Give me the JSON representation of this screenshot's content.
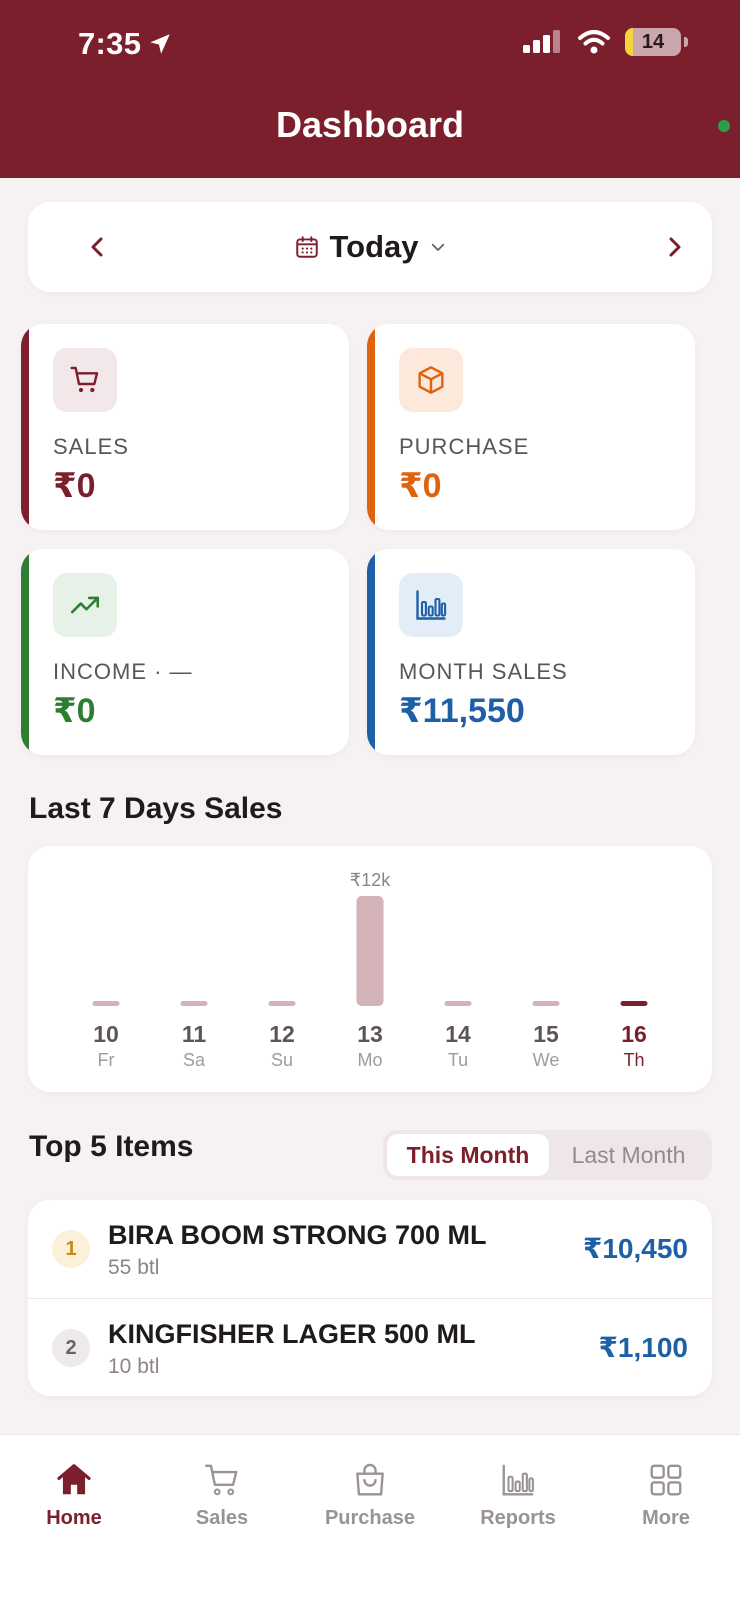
{
  "status_bar": {
    "time": "7:35",
    "battery": "14"
  },
  "header": {
    "title": "Dashboard"
  },
  "date_selector": {
    "label": "Today"
  },
  "stats": {
    "sales": {
      "label": "SALES",
      "value": "₹0",
      "color": "#7a1f2b",
      "icon": "cart-icon"
    },
    "purchase": {
      "label": "PURCHASE",
      "value": "₹0",
      "color": "#e0620f",
      "icon": "box-icon"
    },
    "income": {
      "label": "INCOME · —",
      "value": "₹0",
      "color": "#2e7d32",
      "icon": "trend-up-icon"
    },
    "month_sales": {
      "label": "MONTH SALES",
      "value": "₹11,550",
      "color": "#1f5fa8",
      "icon": "bar-chart-icon"
    }
  },
  "chart_section": {
    "title": "Last 7 Days Sales"
  },
  "chart_data": {
    "type": "bar",
    "categories": [
      "10",
      "11",
      "12",
      "13",
      "14",
      "15",
      "16"
    ],
    "weekdays": [
      "Fr",
      "Sa",
      "Su",
      "Mo",
      "Tu",
      "We",
      "Th"
    ],
    "values": [
      0,
      0,
      0,
      11550,
      0,
      0,
      0
    ],
    "data_labels": [
      "",
      "",
      "",
      "₹12k",
      "",
      "",
      ""
    ],
    "highlighted_index": 6,
    "title": "Last 7 Days Sales",
    "bar_color": "#d4b3b8",
    "highlight_color": "#7a1f2b"
  },
  "top_items": {
    "title": "Top 5 Items",
    "tabs": {
      "active": "This Month",
      "inactive": "Last Month"
    },
    "items": [
      {
        "rank": "1",
        "name": "BIRA BOOM STRONG 700 ML",
        "qty": "55 btl",
        "amount": "₹10,450"
      },
      {
        "rank": "2",
        "name": "KINGFISHER LAGER 500 ML",
        "qty": "10 btl",
        "amount": "₹1,100"
      }
    ]
  },
  "bottom_nav": {
    "items": [
      {
        "label": "Home",
        "icon": "home-icon"
      },
      {
        "label": "Sales",
        "icon": "cart-icon"
      },
      {
        "label": "Purchase",
        "icon": "shopping-bag-icon"
      },
      {
        "label": "Reports",
        "icon": "bar-chart-icon"
      },
      {
        "label": "More",
        "icon": "grid-icon"
      }
    ]
  }
}
